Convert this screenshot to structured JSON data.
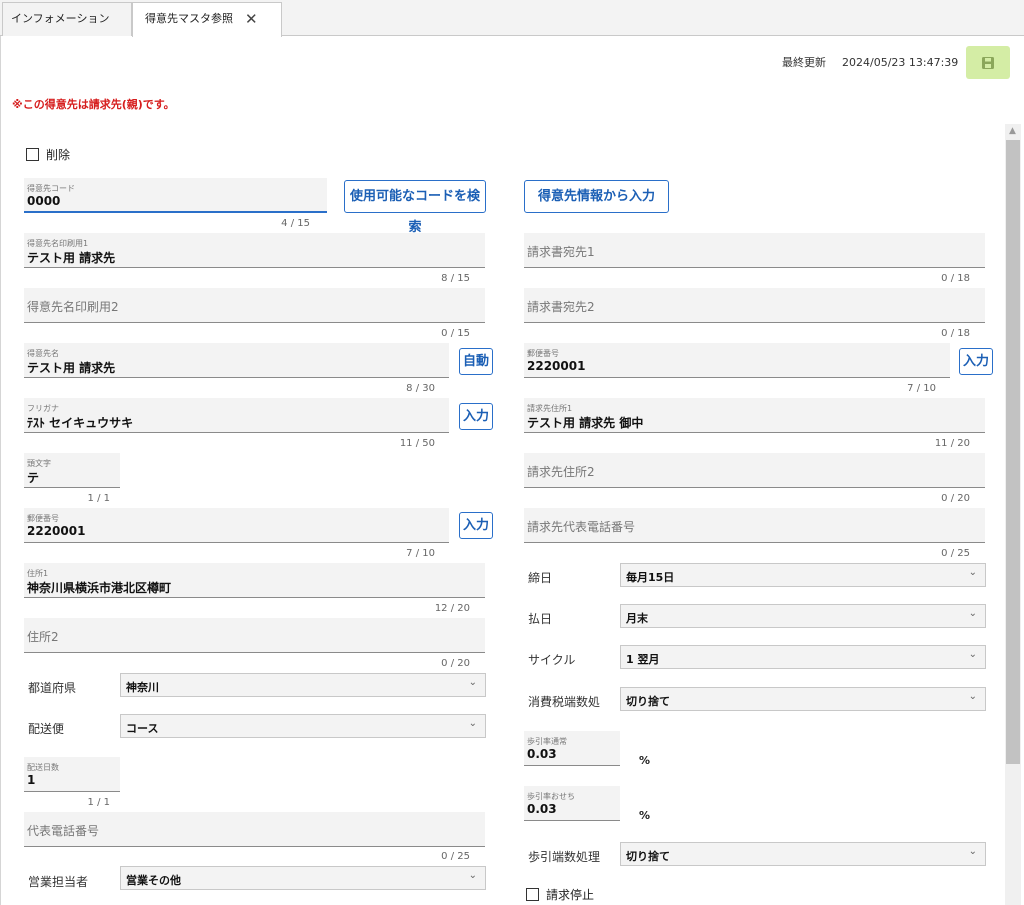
{
  "tabs": {
    "info_label": "インフォメーション",
    "active_label": "得意先マスタ参照",
    "close_glyph": "✕"
  },
  "header": {
    "last_update_label": "最終更新",
    "last_update_value": "2024/05/23 13:47:39",
    "save_icon": "floppy-disk-icon",
    "save_color": "#d4eda5"
  },
  "notice": "※この得意先は請求先(親)です。",
  "delete_label": "削除",
  "left": {
    "code": {
      "label": "得意先コード",
      "value": "0000",
      "count": "4 / 15"
    },
    "search_code_button": "使用可能なコードを検索",
    "print_name1": {
      "label": "得意先名印刷用1",
      "value": "テスト用 請求先",
      "count": "8 / 15"
    },
    "print_name2": {
      "label": "得意先名印刷用2",
      "value": "",
      "count": "0 / 15"
    },
    "name": {
      "label": "得意先名",
      "value": "テスト用 請求先",
      "count": "8 / 30"
    },
    "auto_button": "自動",
    "kana": {
      "label": "フリガナ",
      "value": "ﾃｽﾄ セイキュウサキ",
      "count": "11 / 50"
    },
    "kana_input_button": "入力",
    "initial": {
      "label": "頭文字",
      "value": "テ",
      "count": "1 / 1"
    },
    "postal": {
      "label": "郵便番号",
      "value": "2220001",
      "count": "7 / 10"
    },
    "postal_input_button": "入力",
    "address1": {
      "label": "住所1",
      "value": "神奈川県横浜市港北区樽町",
      "count": "12 / 20"
    },
    "address2": {
      "label": "住所2",
      "value": "",
      "count": "0 / 20"
    },
    "prefecture": {
      "label": "都道府県",
      "value": "神奈川"
    },
    "delivery": {
      "label": "配送便",
      "value": "コース"
    },
    "delivery_days": {
      "label": "配送日数",
      "value": "1",
      "count": "1 / 1"
    },
    "phone": {
      "label": "代表電話番号",
      "value": "",
      "count": "0 / 25"
    },
    "sales_rep": {
      "label": "営業担当者",
      "value": "営業その他"
    }
  },
  "right": {
    "input_from_customer_button": "得意先情報から入力",
    "bill_to1": {
      "label": "請求書宛先1",
      "value": "",
      "count": "0 / 18"
    },
    "bill_to2": {
      "label": "請求書宛先2",
      "value": "",
      "count": "0 / 18"
    },
    "postal": {
      "label": "郵便番号",
      "value": "2220001",
      "count": "7 / 10"
    },
    "postal_input_button": "入力",
    "bill_address1": {
      "label": "請求先住所1",
      "value": "テスト用 請求先 御中",
      "count": "11 / 20"
    },
    "bill_address2": {
      "label": "請求先住所2",
      "value": "",
      "count": "0 / 20"
    },
    "bill_phone": {
      "label": "請求先代表電話番号",
      "value": "",
      "count": "0 / 25"
    },
    "closing_day": {
      "label": "締日",
      "value": "毎月15日"
    },
    "payment_day": {
      "label": "払日",
      "value": "月末"
    },
    "cycle": {
      "label": "サイクル",
      "value": "1 翌月"
    },
    "tax_rounding": {
      "label": "消費税端数処",
      "value": "切り捨て"
    },
    "rate_normal": {
      "label": "歩引率通常",
      "value": "0.03",
      "unit": "%"
    },
    "rate_oseibo": {
      "label": "歩引率おせち",
      "value": "0.03",
      "unit": "%"
    },
    "rate_rounding": {
      "label": "歩引端数処理",
      "value": "切り捨て"
    },
    "billing_stop_label": "請求停止"
  },
  "chevron_glyph": "⌄",
  "scroll_up_glyph": "▲"
}
